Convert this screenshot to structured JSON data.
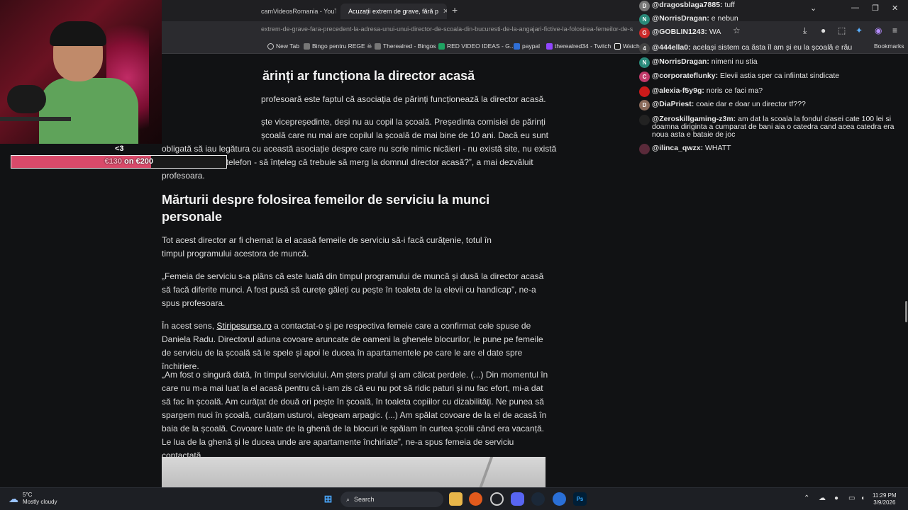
{
  "browser": {
    "tabs": [
      {
        "label": "camVideosRomania - YouT"
      },
      {
        "label": "Acuzații extrem de grave, fără p"
      }
    ],
    "url": "extrem-de-grave-fara-precedent-la-adresa-unui-unui-director-de-scoala-din-bucuresti-de-la-angajari-fictive-la-folosirea-femeilor-de-s",
    "bookmarks": [
      {
        "label": "New Tab",
        "color": "#cccccc"
      },
      {
        "label": "Bingo pentru REGE ☠",
        "color": "#777777"
      },
      {
        "label": "Therealred - Bingos",
        "color": "#777777"
      },
      {
        "label": "RED VIDEO IDEAS - G...",
        "color": "#1ea362"
      },
      {
        "label": "paypal",
        "color": "#2f6fd6"
      },
      {
        "label": "therealred34 - Twitch",
        "color": "#9146ff"
      },
      {
        "label": "Watch",
        "color": "#222222"
      }
    ],
    "bookmarks_label": "Bookmarks"
  },
  "article": {
    "heading1": "ărinți ar funcționa la director acasă",
    "p1": "profesoară este faptul că asociația de părinți funcționează la director acasă.",
    "p2a": "ște vicepreședinte, deși nu au copil la școală. Președinta comisiei de părinți",
    "p2b": "școală care nu mai are copilul la școală de mai bine de 10 ani. Dacă eu sunt",
    "p2c": "obligată să iau legătura cu această asociație despre care nu scrie nimic nicăieri - nu există site, nu există",
    "p2d": "e-mail, nu există telefon - să înțeleg că trebuie să merg la domnul director acasă?”, a mai dezvăluit",
    "p2e": "profesoara.",
    "heading2": "Mărturii despre folosirea femeilor de serviciu la munci personale",
    "p3": "Tot acest director ar fi chemat la el acasă femeile de serviciu să-i facă curățenie, totul în timpul programului acestora de muncă.",
    "p4": "„Femeia de serviciu s-a plâns că este luată din timpul programului de muncă și dusă la director acasă să facă diferite munci. A fost pusă să curețe găleți cu pește în toaleta de la elevii cu handicap”, ne-a spus profesoara.",
    "p5_pre": "În acest sens, ",
    "p5_link": "Stiripesurse.ro",
    "p5_post": " a contactat-o și pe respectiva femeie care a confirmat cele spuse de Daniela Radu. Directorul aduna covoare aruncate de oameni la ghenele blocurilor, le pune pe femeile de serviciu de la școală să le spele și apoi le ducea în apartamentele pe care le are el date spre închiriere.",
    "p6": "„Am fost o singură dată, în timpul serviciului. Am șters praful și am călcat perdele. (...) Din momentul în care nu m-a mai luat la el acasă pentru că i-am zis că eu nu pot să ridic paturi și nu fac efort, mi-a dat să fac în școală. Am curățat de două ori pește în școală, în toaleta copiilor cu dizabilități. Ne punea să spargem nuci în școală, curățam usturoi, alegeam arpagic. (...) Am spălat covoare de la el de acasă în baia de la școală. Covoare luate de la ghenă de la blocuri le spălam în curtea școlii când era vacanță. Le lua de la ghenă și le ducea unde are apartamente închiriate”, ne-a spus femeia de serviciu contactată."
  },
  "overlay": {
    "heart": "<3",
    "goal_current": "€130",
    "goal_text": " on €200",
    "goal_progress": 0.65
  },
  "chat": [
    {
      "user": "@dragosblaga7885:",
      "text": "tuff",
      "initial": "D",
      "color": "#777777"
    },
    {
      "user": "@NorrisDragan:",
      "text": "e nebun",
      "initial": "N",
      "color": "#2a8a7a"
    },
    {
      "user": "@GOBLIN1243:",
      "text": "WA",
      "initial": "G",
      "color": "#cc2a2a"
    },
    {
      "user": "@444ella0:",
      "text": "același sistem ca ăsta îl am și eu la școală e rău",
      "initial": "4",
      "color": "#444444"
    },
    {
      "user": "@NorrisDragan:",
      "text": "nimeni nu stia",
      "initial": "N",
      "color": "#2a8a7a"
    },
    {
      "user": "@corporateflunky:",
      "text": "Elevii astia sper ca infiintat sindicate",
      "initial": "C",
      "color": "#c23a6a"
    },
    {
      "user": "@alexia-f5y9g:",
      "text": "noris ce faci ma?",
      "initial": "",
      "color": "#cc1a1a"
    },
    {
      "user": "@DiaPriest:",
      "text": "coaie dar e doar un director tf???",
      "initial": "D",
      "color": "#8a6a5a"
    },
    {
      "user": "@Zeroskillgaming-z3m:",
      "text": "am dat la scoala la fondul clasei cate 100 lei si doamna diriginta a cumparat de bani aia o catedra cand acea catedra era noua asta e bataie de joc",
      "initial": "",
      "color": "#222222"
    },
    {
      "user": "@ilinca_qwzx:",
      "text": "WHATT",
      "initial": "",
      "color": "#5a2a3a"
    }
  ],
  "taskbar": {
    "temp": "5°C",
    "weather": "Mostly cloudy",
    "search_placeholder": "Search",
    "time": "11:29 PM",
    "date": "3/9/2026"
  }
}
